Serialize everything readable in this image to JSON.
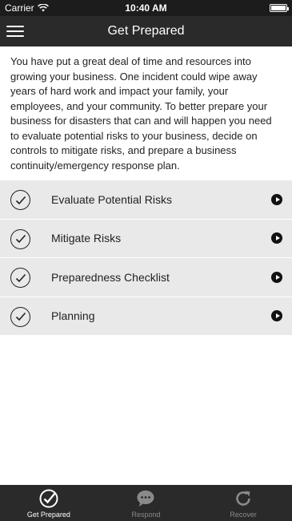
{
  "status_bar": {
    "carrier": "Carrier",
    "time": "10:40 AM"
  },
  "header": {
    "title": "Get Prepared",
    "menu_icon": "hamburger-menu-icon"
  },
  "intro_text": "You have put a great deal of time and resources into growing your business. One incident could wipe away years of hard work and impact your family, your employees, and your community. To better prepare your business for disasters that can and will happen you need to evaluate potential risks to your business, decide on controls to mitigate risks, and prepare a business continuity/emergency response plan.",
  "list": {
    "items": [
      {
        "label": "Evaluate Potential Risks"
      },
      {
        "label": "Mitigate Risks"
      },
      {
        "label": "Preparedness Checklist"
      },
      {
        "label": "Planning"
      }
    ]
  },
  "tab_bar": {
    "tabs": [
      {
        "label": "Get Prepared",
        "icon": "check-circle-icon",
        "active": true
      },
      {
        "label": "Respond",
        "icon": "chat-bubble-icon",
        "active": false
      },
      {
        "label": "Recover",
        "icon": "refresh-icon",
        "active": false
      }
    ]
  },
  "colors": {
    "nav_background": "#2a2a2a",
    "list_background": "#e9e9e9",
    "inactive_tab": "#8a8a8a"
  }
}
